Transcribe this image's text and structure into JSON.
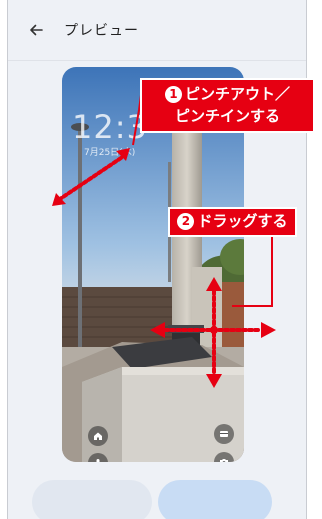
{
  "appbar": {
    "back_icon": "arrow-left-icon",
    "title": "プレビュー"
  },
  "preview": {
    "clock": "12:3",
    "date": "7月25日(木)"
  },
  "shortcuts": {
    "home_icon": "home-icon",
    "mic_icon": "microphone-icon",
    "wallet_icon": "wallet-icon",
    "camera_icon": "camera-icon"
  },
  "annotations": {
    "step1_number": "1",
    "step1_line1": "ピンチアウト／",
    "step1_line2": "ピンチインする",
    "step2_number": "2",
    "step2_text": "ドラッグする"
  },
  "colors": {
    "callout": "#e60012",
    "arrow": "#e60012",
    "background": "#eef1f6"
  }
}
